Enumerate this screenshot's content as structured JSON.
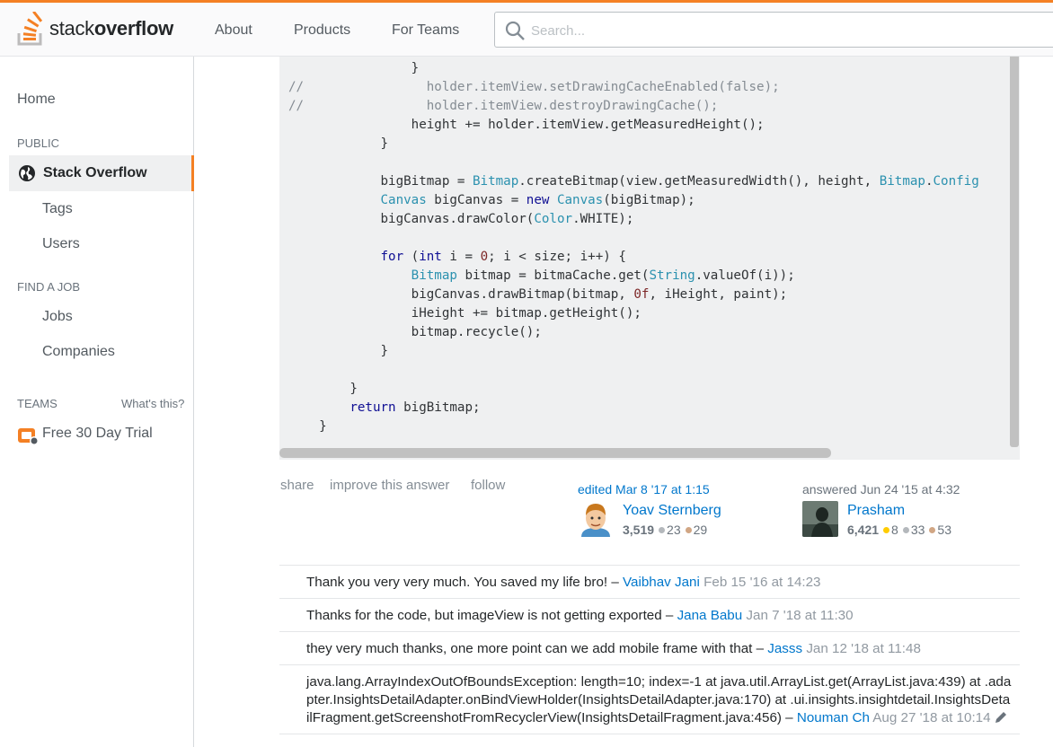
{
  "brand": {
    "name_light": "stack",
    "name_bold": "overflow",
    "accent": "#f48024",
    "link": "#0077cc"
  },
  "topnav": {
    "about": "About",
    "products": "Products",
    "for_teams": "For Teams"
  },
  "search": {
    "placeholder": "Search..."
  },
  "sidebar": {
    "home": "Home",
    "public_heading": "PUBLIC",
    "active": "Stack Overflow",
    "tags": "Tags",
    "users": "Users",
    "jobs_heading": "FIND A JOB",
    "jobs": "Jobs",
    "companies": "Companies",
    "teams_heading": "TEAMS",
    "whats_this": "What's this?",
    "trial": "Free 30 Day Trial"
  },
  "post_menu": {
    "share": "share",
    "improve": "improve this answer",
    "follow": "follow"
  },
  "editor": {
    "label": "edited Mar 8 '17 at 1:15",
    "name": "Yoav Sternberg",
    "rep": "3,519",
    "silver": "23",
    "bronze": "29"
  },
  "answerer": {
    "label": "answered Jun 24 '15 at 4:32",
    "name": "Prasham",
    "rep": "6,421",
    "gold": "8",
    "silver": "33",
    "bronze": "53"
  },
  "comments": [
    {
      "text": "Thank you very very much. You saved my life bro! – ",
      "user": "Vaibhav Jani",
      "date": "Feb 15 '16 at 14:23"
    },
    {
      "text": "Thanks for the code, but imageView is not getting exported – ",
      "user": "Jana Babu",
      "date": "Jan 7 '18 at 11:30"
    },
    {
      "text": "they very much thanks, one more point can we add mobile frame with that – ",
      "user": "Jasss",
      "date": "Jan 12 '18 at 11:48"
    },
    {
      "text": "java.lang.ArrayIndexOutOfBoundsException: length=10; index=-1 at java.util.ArrayList.get(ArrayList.java:439) at .adapter.InsightsDetailAdapter.onBindViewHolder(InsightsDetailAdapter.java:170) at .ui.insights.insightdetail.InsightsDetailFragment.getScreenshotFromRecyclerView(InsightsDetailFragment.java:456) – ",
      "user": "Nouman Ch",
      "date": "Aug 27 '18 at 10:14"
    }
  ]
}
